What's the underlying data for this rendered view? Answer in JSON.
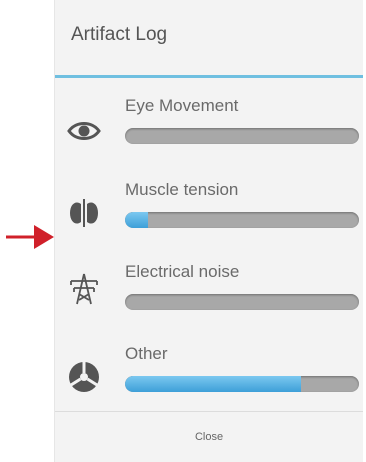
{
  "panel": {
    "title": "Artifact Log",
    "close_label": "Close"
  },
  "items": [
    {
      "label": "Eye Movement",
      "icon": "eye-icon",
      "level": 0.0
    },
    {
      "label": "Muscle tension",
      "icon": "muscle-icon",
      "level": 0.1
    },
    {
      "label": "Electrical noise",
      "icon": "power-tower-icon",
      "level": 0.0
    },
    {
      "label": "Other",
      "icon": "other-icon",
      "level": 0.75
    }
  ],
  "colors": {
    "accent": "#6fbfe0",
    "fill": "#3d9fd8",
    "track": "#a8a8a8",
    "pointer_arrow": "#d0202a"
  }
}
